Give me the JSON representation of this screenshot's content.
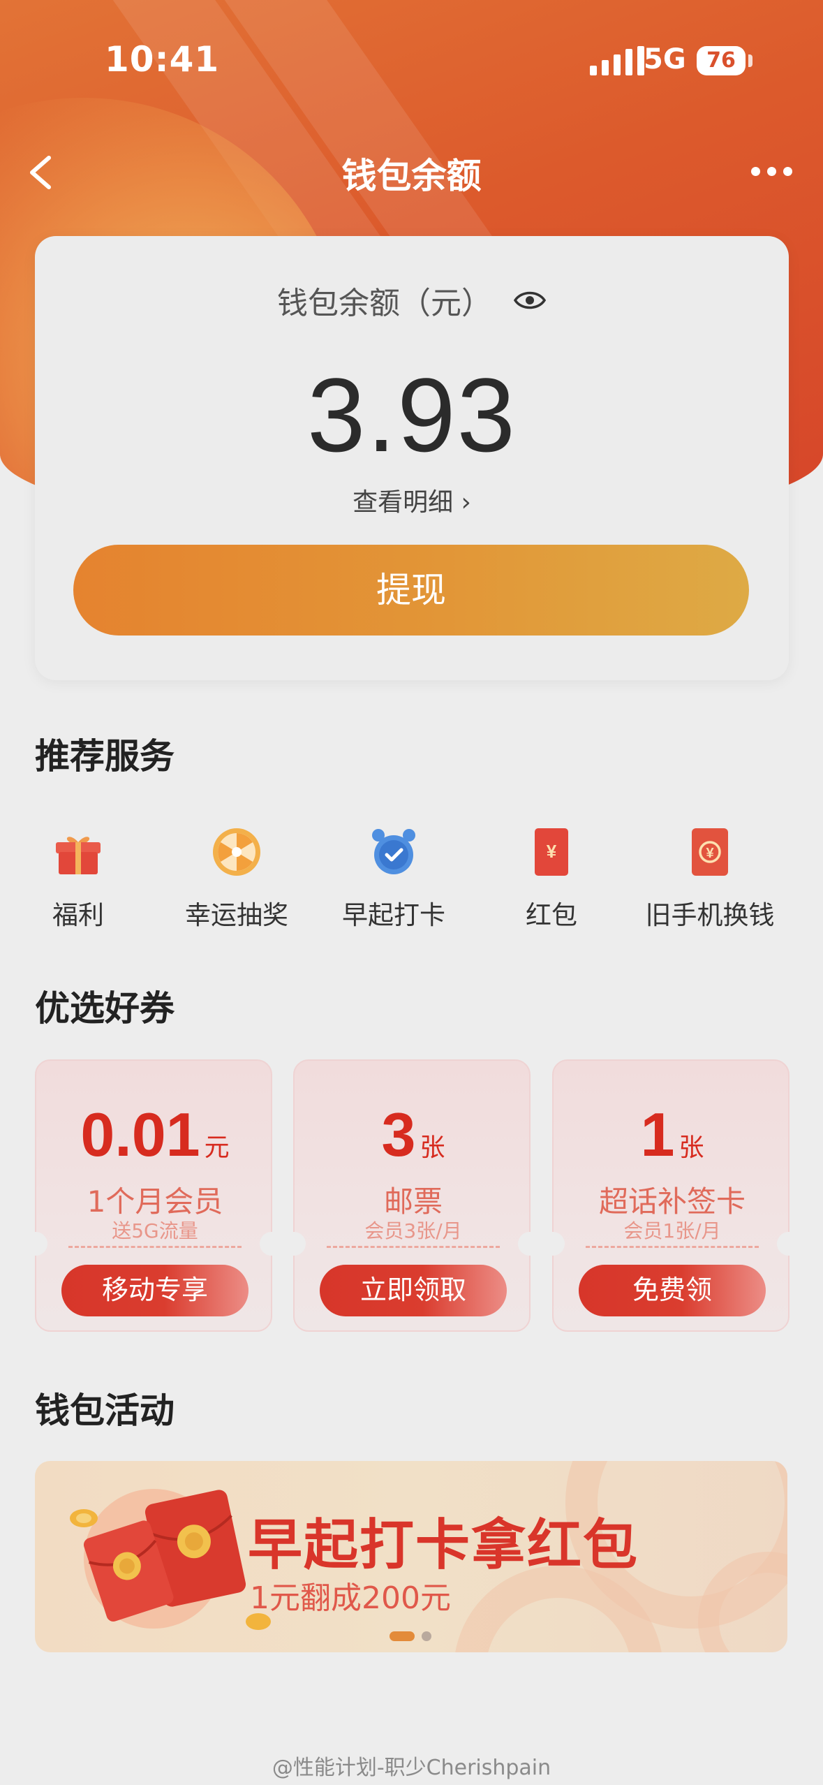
{
  "status_bar": {
    "time": "10:41",
    "network": "5G",
    "battery": "76"
  },
  "nav": {
    "title": "钱包余额"
  },
  "balance": {
    "label": "钱包余额（元）",
    "amount": "3.93",
    "detail_link": "查看明细 ›",
    "withdraw_label": "提现"
  },
  "services": {
    "title": "推荐服务",
    "items": [
      {
        "label": "福利",
        "icon": "gift-icon"
      },
      {
        "label": "幸运抽奖",
        "icon": "wheel-icon"
      },
      {
        "label": "早起打卡",
        "icon": "alarm-clock-icon"
      },
      {
        "label": "红包",
        "icon": "red-envelope-icon"
      },
      {
        "label": "旧手机换钱",
        "icon": "exchange-icon"
      }
    ]
  },
  "coupons": {
    "title": "优选好券",
    "items": [
      {
        "value": "0.01",
        "unit": "元",
        "title": "1个月会员",
        "sub": "送5G流量",
        "button": "移动专享"
      },
      {
        "value": "3",
        "unit": "张",
        "title": "邮票",
        "sub": "会员3张/月",
        "button": "立即领取"
      },
      {
        "value": "1",
        "unit": "张",
        "title": "超话补签卡",
        "sub": "会员1张/月",
        "button": "免费领"
      }
    ]
  },
  "activities": {
    "title": "钱包活动",
    "banner_title": "早起打卡拿红包",
    "banner_sub": "1元翻成200元"
  },
  "watermark": "@性能计划-职少Cherishpain",
  "colors": {
    "accent": "#d9352a",
    "brand_orange": "#e5832f",
    "background": "#ededed"
  }
}
